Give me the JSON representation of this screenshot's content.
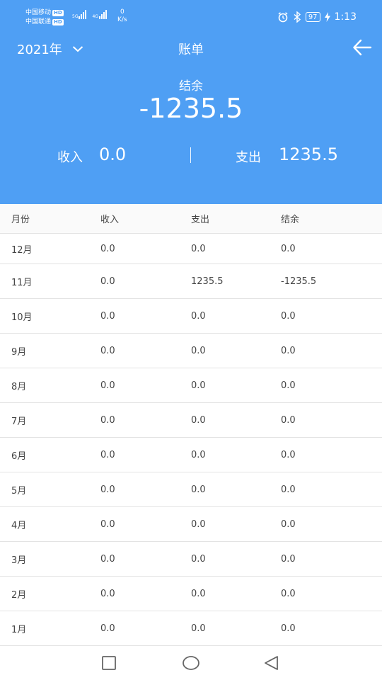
{
  "status_bar": {
    "carrier1": "中国移动",
    "carrier2": "中国联通",
    "hd": "HD",
    "sig1_label": "5G",
    "sig2_label": "4G",
    "net_speed_value": "0",
    "net_speed_unit": "K/s",
    "battery": "97",
    "time": "1:13",
    "icons": [
      "alarm-icon",
      "bluetooth-icon",
      "battery-icon",
      "charging-icon"
    ]
  },
  "header": {
    "year": "2021年",
    "title": "账单",
    "balance_label": "结余",
    "balance_value": "-1235.5",
    "income_label": "收入",
    "income_value": "0.0",
    "expense_label": "支出",
    "expense_value": "1235.5"
  },
  "table": {
    "headers": [
      "月份",
      "收入",
      "支出",
      "结余"
    ],
    "rows": [
      [
        "12月",
        "0.0",
        "0.0",
        "0.0"
      ],
      [
        "11月",
        "0.0",
        "1235.5",
        "-1235.5"
      ],
      [
        "10月",
        "0.0",
        "0.0",
        "0.0"
      ],
      [
        "9月",
        "0.0",
        "0.0",
        "0.0"
      ],
      [
        "8月",
        "0.0",
        "0.0",
        "0.0"
      ],
      [
        "7月",
        "0.0",
        "0.0",
        "0.0"
      ],
      [
        "6月",
        "0.0",
        "0.0",
        "0.0"
      ],
      [
        "5月",
        "0.0",
        "0.0",
        "0.0"
      ],
      [
        "4月",
        "0.0",
        "0.0",
        "0.0"
      ],
      [
        "3月",
        "0.0",
        "0.0",
        "0.0"
      ],
      [
        "2月",
        "0.0",
        "0.0",
        "0.0"
      ],
      [
        "1月",
        "0.0",
        "0.0",
        "0.0"
      ]
    ]
  },
  "colors": {
    "header_bg": "#4f9ff4",
    "header_text": "#ffffff",
    "table_text": "#444444",
    "divider": "#e3e3e3"
  }
}
